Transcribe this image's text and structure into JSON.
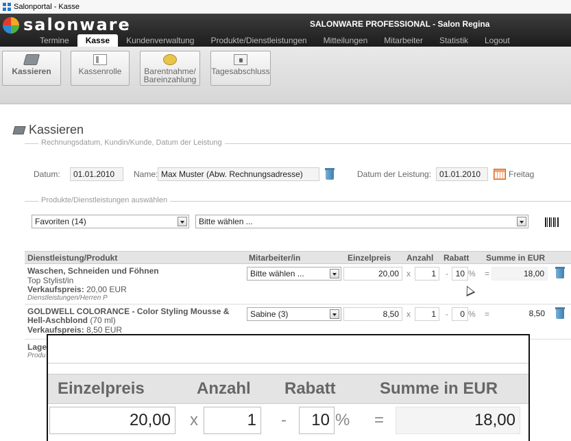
{
  "window": {
    "title": "Salonportal - Kasse"
  },
  "header": {
    "logo_text": "salonware",
    "product_title": "SALONWARE PROFESSIONAL - Salon Regina",
    "nav": [
      "Termine",
      "Kasse",
      "Kundenverwaltung",
      "Produkte/Dienstleistungen",
      "Mitteilungen",
      "Mitarbeiter",
      "Statistik",
      "Logout"
    ],
    "active_nav": "Kasse"
  },
  "toolbar": {
    "buttons": [
      {
        "label": "Kassieren",
        "icon": "cash-register-icon",
        "active": true
      },
      {
        "label": "Kassenrolle",
        "icon": "cash-roll-icon",
        "active": false
      },
      {
        "label": "Barentnahme/",
        "label2": "Bareinzahlung",
        "icon": "coins-icon",
        "active": false
      },
      {
        "label": "Tagesabschluss",
        "icon": "daily-closing-icon",
        "active": false
      }
    ]
  },
  "page": {
    "title": "Kassieren"
  },
  "invoice": {
    "legend": "Rechnungsdatum, Kundin/Kunde, Datum der Leistung",
    "datum_label": "Datum:",
    "datum_value": "01.01.2010",
    "name_label": "Name:",
    "name_value": "Max Muster (Abw. Rechnungsadresse)",
    "leistung_label": "Datum der Leistung:",
    "leistung_value": "01.01.2010",
    "weekday": "Freitag"
  },
  "products_select": {
    "legend": "Produkte/Dienstleistungen auswählen",
    "favorites": "Favoriten (14)",
    "choose": "Bitte wählen ..."
  },
  "table": {
    "headers": {
      "product": "Dienstleistung/Produkt",
      "staff": "Mitarbeiter/in",
      "price": "Einzelpreis",
      "qty": "Anzahl",
      "discount": "Rabatt",
      "sum": "Summe in EUR"
    },
    "symbols": {
      "times": "x",
      "minus": "-",
      "percent": "%",
      "equals": "="
    },
    "rows": [
      {
        "name": "Waschen, Schneiden und Föhnen",
        "sub": "Top Stylist/in",
        "price_label": "Verkaufspreis:",
        "price_value": "20,00 EUR",
        "category": "Dienstleistungen/Herren P",
        "staff": "Bitte wählen ...",
        "unit_price": "20,00",
        "qty": "1",
        "discount": "10",
        "sum": "18,00"
      },
      {
        "name_line1": "GOLDWELL COLORANCE - Color Styling Mousse &",
        "name_line2": "Hell-Aschblond",
        "name_suffix": "(70 ml)",
        "price_label": "Verkaufspreis:",
        "price_value": "8,50 EUR",
        "extra_label": "Lage",
        "extra_cat": "Produ",
        "staff": "Sabine (3)",
        "unit_price": "8,50",
        "qty": "1",
        "discount": "0",
        "sum": "8,50"
      }
    ]
  },
  "zoom": {
    "price_header": "Einzelpreis",
    "qty_header": "Anzahl",
    "discount_header": "Rabatt",
    "sum_header": "Summe in EUR",
    "unit_price": "20,00",
    "qty": "1",
    "discount": "10",
    "sum": "18,00"
  }
}
